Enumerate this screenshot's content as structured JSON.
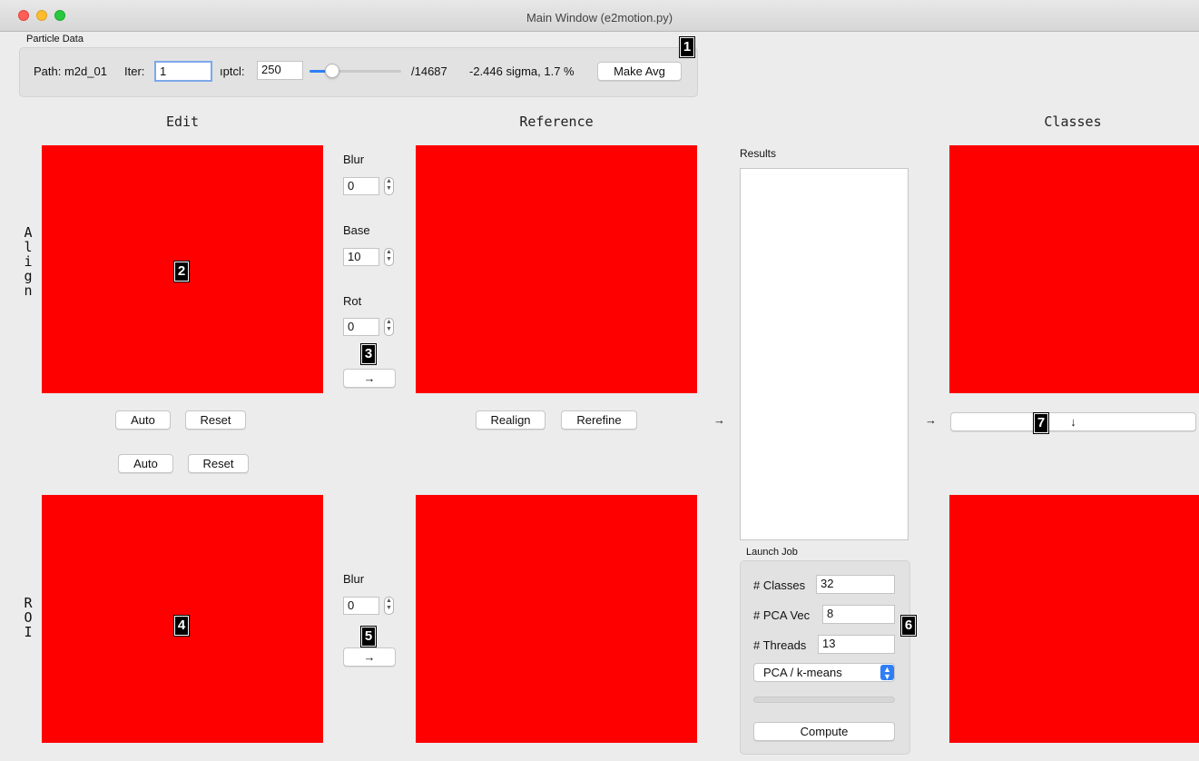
{
  "window": {
    "title": "Main Window (e2motion.py)"
  },
  "particle_data": {
    "group_label": "Particle Data",
    "path_label": "Path: m2d_01",
    "iter_label": "Iter:",
    "iter_value": "1",
    "iptcl_label": "ıptcl:",
    "iptcl_value": "250",
    "slider_fraction": 0.017,
    "total": "/14687",
    "sigma": "-2.446 sigma, 1.7 %",
    "make_avg": "Make Avg"
  },
  "headings": {
    "edit": "Edit",
    "reference": "Reference",
    "classes": "Classes"
  },
  "row_labels": {
    "align": "Align",
    "roi": "ROI"
  },
  "align_controls": {
    "blur_label": "Blur",
    "blur_value": "0",
    "base_label": "Base",
    "base_value": "10",
    "rot_label": "Rot",
    "rot_value": "0",
    "arrow": "→"
  },
  "roi_controls": {
    "blur_label": "Blur",
    "blur_value": "0",
    "arrow": "→"
  },
  "edit_buttons": {
    "auto": "Auto",
    "reset": "Reset",
    "auto2": "Auto",
    "reset2": "Reset"
  },
  "reference_buttons": {
    "realign": "Realign",
    "rerefine": "Rerefine"
  },
  "arrows": {
    "to_results": "→",
    "to_classes": "→",
    "down": "↓"
  },
  "results": {
    "label": "Results"
  },
  "launch_job": {
    "group_label": "Launch Job",
    "classes_label": "# Classes",
    "classes_value": "32",
    "pca_label": "# PCA Vec",
    "pca_value": "8",
    "threads_label": "# Threads",
    "threads_value": "13",
    "method": "PCA / k-means",
    "progress": 0,
    "compute": "Compute"
  },
  "badges": {
    "b1": "1",
    "b2": "2",
    "b3": "3",
    "b4": "4",
    "b5": "5",
    "b6": "6",
    "b7": "7"
  },
  "colors": {
    "panel": "#ff0000",
    "accent": "#2f7ef6",
    "close": "#fe5f57",
    "minimize": "#febc2e",
    "zoom": "#28c840"
  }
}
